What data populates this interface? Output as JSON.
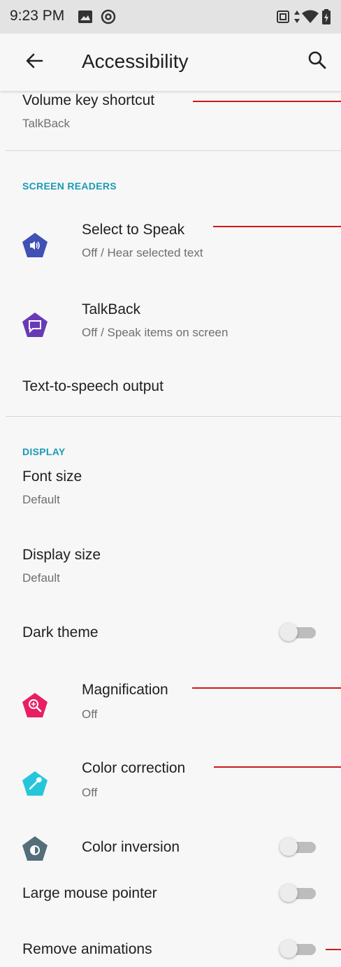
{
  "status_bar": {
    "time": "9:23 PM"
  },
  "app_bar": {
    "title": "Accessibility"
  },
  "volume_key_shortcut": {
    "title": "Volume key shortcut",
    "summary": "TalkBack"
  },
  "screen_readers": {
    "header": "SCREEN READERS",
    "items": [
      {
        "title": "Select to Speak",
        "summary": "Off / Hear selected text",
        "icon": "select-to-speak-icon",
        "color": "#3f51b5"
      },
      {
        "title": "TalkBack",
        "summary": "Off / Speak items on screen",
        "icon": "talkback-icon",
        "color": "#673ab7"
      }
    ],
    "tts": "Text-to-speech output"
  },
  "display": {
    "header": "DISPLAY",
    "font_size": {
      "title": "Font size",
      "summary": "Default"
    },
    "display_size": {
      "title": "Display size",
      "summary": "Default"
    },
    "dark_theme": {
      "title": "Dark theme",
      "on": false
    },
    "magnification": {
      "title": "Magnification",
      "summary": "Off",
      "color": "#e91e63"
    },
    "color_correction": {
      "title": "Color correction",
      "summary": "Off",
      "color": "#26c6da"
    },
    "color_inversion": {
      "title": "Color inversion",
      "on": false,
      "color": "#546e7a"
    },
    "large_mouse_pointer": {
      "title": "Large mouse pointer",
      "on": false
    },
    "remove_animations": {
      "title": "Remove animations",
      "on": false
    }
  },
  "colors": {
    "accent": "#1a9bb5",
    "annotation": "#d01818"
  }
}
